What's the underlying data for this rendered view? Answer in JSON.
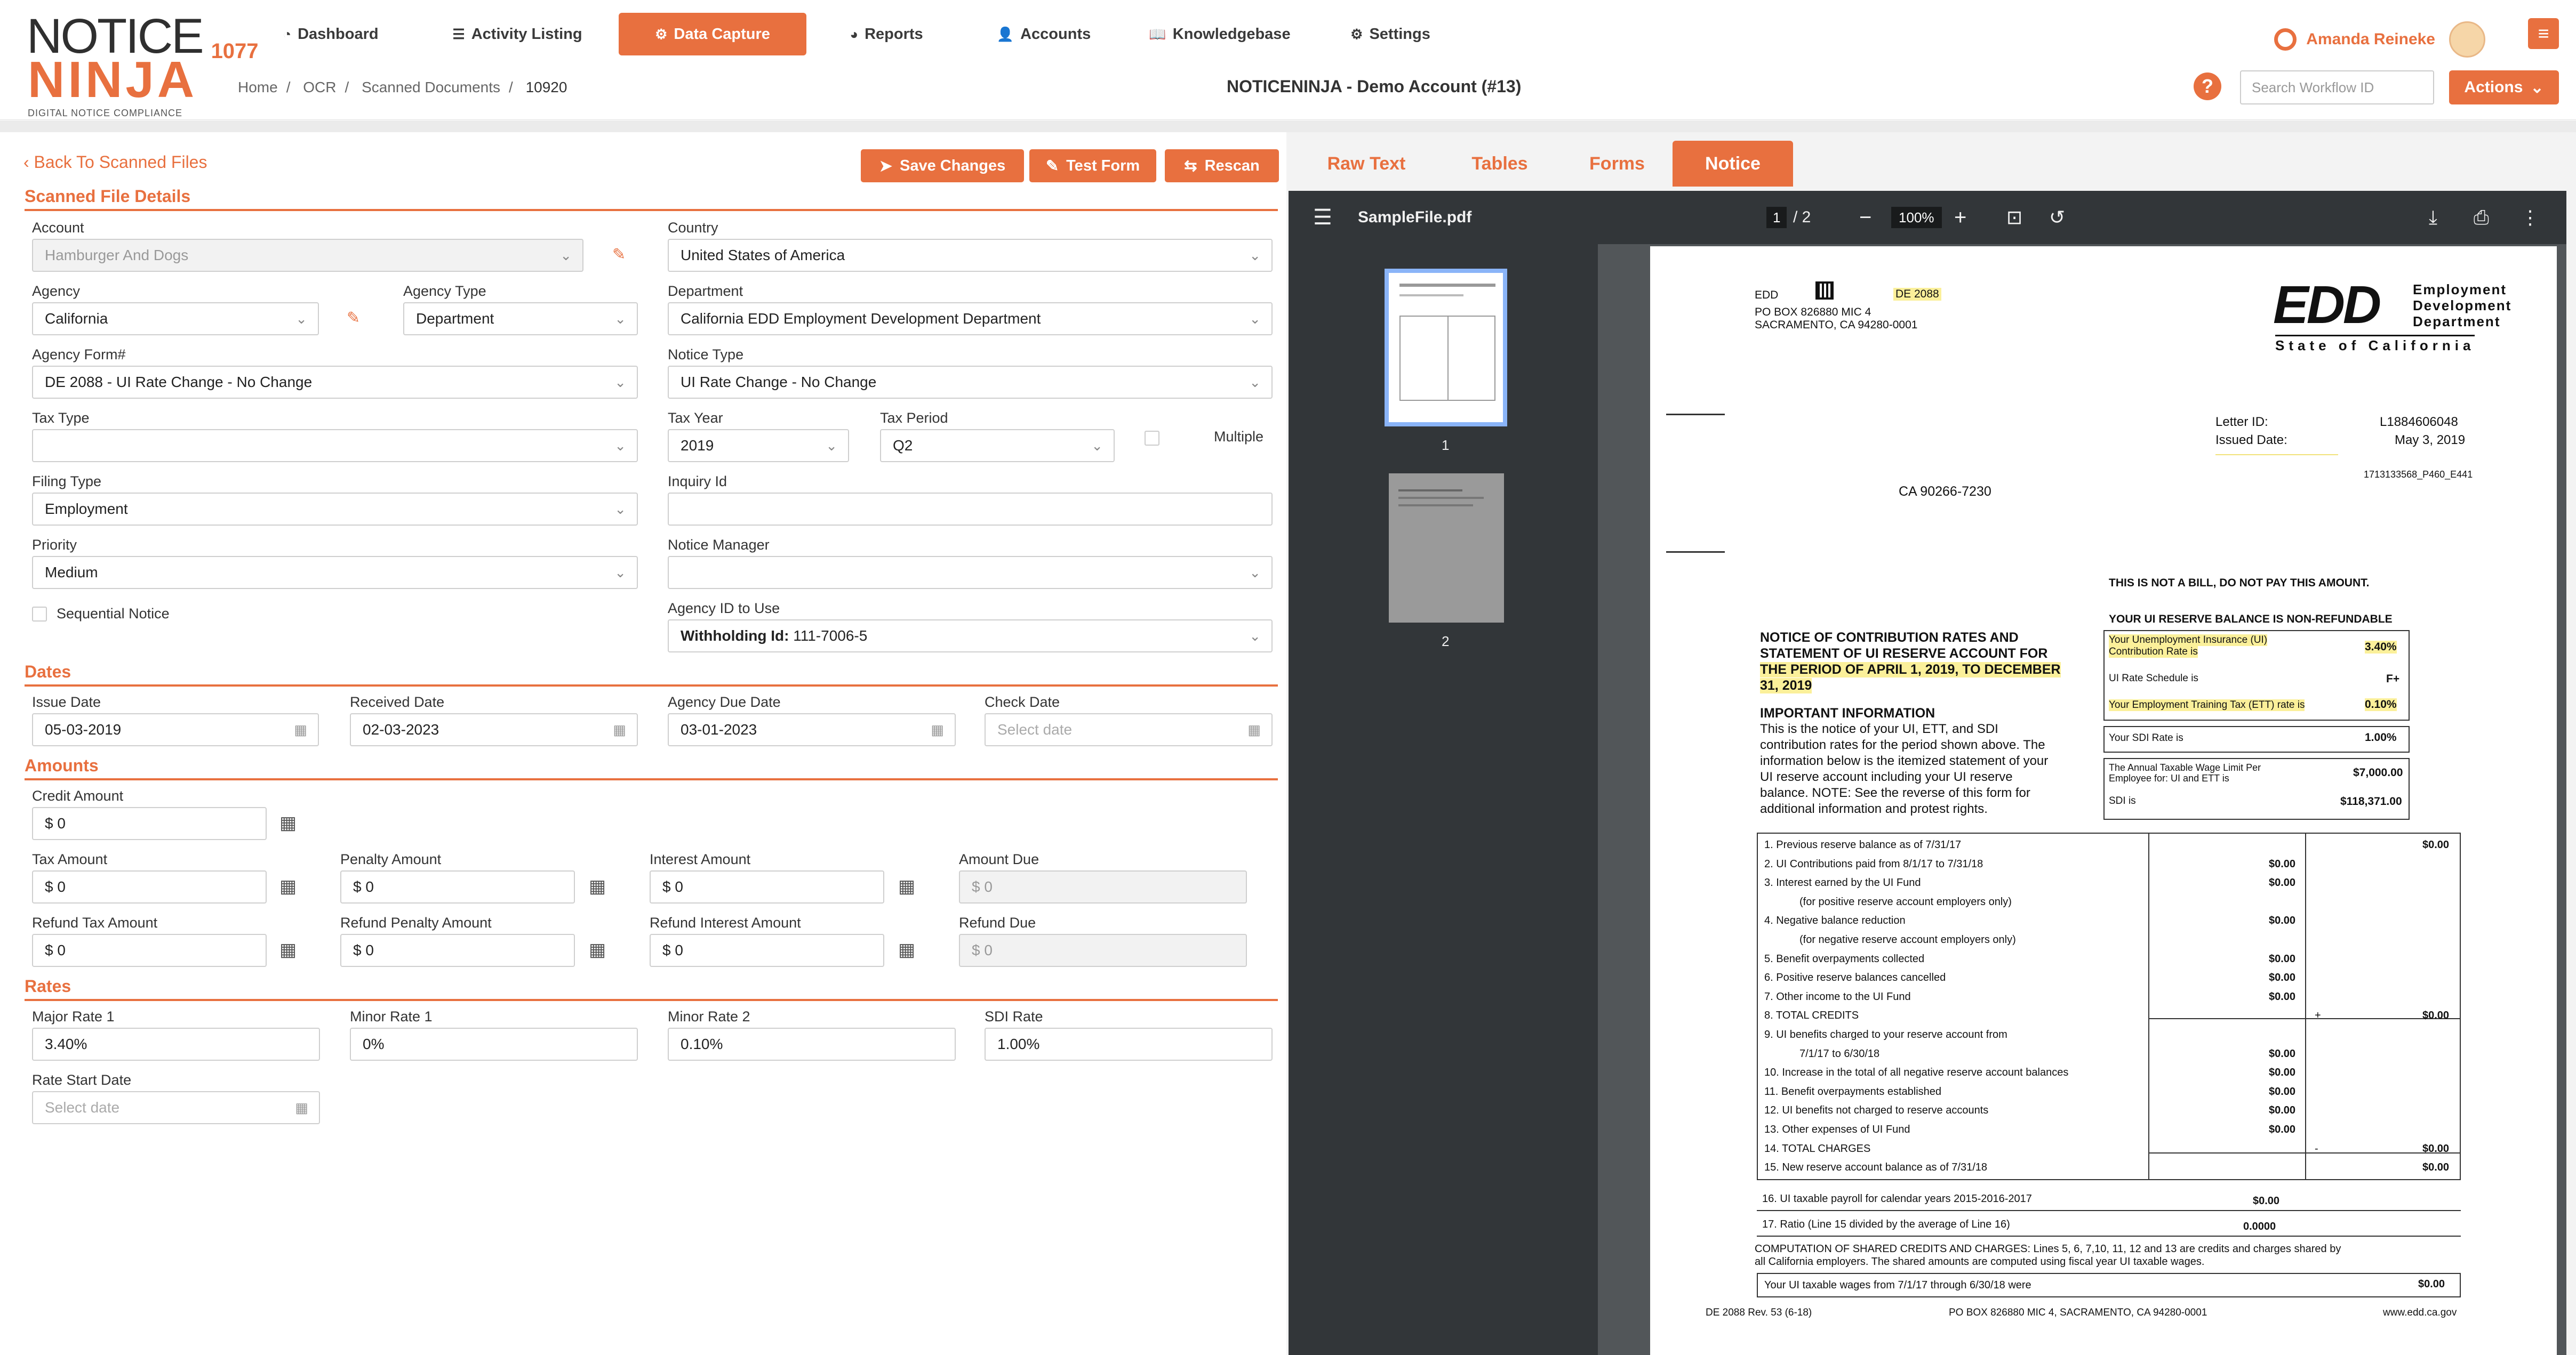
{
  "app": {
    "logo_notice": "NOTICE",
    "logo_number": "1077",
    "logo_ninja": "NINJA",
    "logo_tagline": "DIGITAL NOTICE COMPLIANCE",
    "accent_color": "#e8703f"
  },
  "nav": [
    {
      "label": "Dashboard",
      "icon": "dashboard-icon"
    },
    {
      "label": "Activity Listing",
      "icon": "list-icon"
    },
    {
      "label": "Data Capture",
      "icon": "gear-icon",
      "active": true
    },
    {
      "label": "Reports",
      "icon": "pie-chart-icon"
    },
    {
      "label": "Accounts",
      "icon": "user-icon"
    },
    {
      "label": "Knowledgebase",
      "icon": "book-icon"
    },
    {
      "label": "Settings",
      "icon": "cog-icon"
    }
  ],
  "user": {
    "name": "Amanda Reineke"
  },
  "breadcrumb": [
    "Home",
    "OCR",
    "Scanned Documents",
    "10920"
  ],
  "account_title": "NOTICENINJA - Demo Account (#13)",
  "search": {
    "placeholder": "Search Workflow ID"
  },
  "actions_label": "Actions",
  "form": {
    "back_label": "Back To Scanned Files",
    "save_label": "Save Changes",
    "test_label": "Test Form",
    "rescan_label": "Rescan",
    "section_details": "Scanned File Details",
    "account_label": "Account",
    "account_value": "Hamburger And Dogs",
    "country_label": "Country",
    "country_value": "United States of America",
    "agency_label": "Agency",
    "agency_value": "California",
    "agency_type_label": "Agency Type",
    "agency_type_value": "Department",
    "department_label": "Department",
    "department_value": "California EDD Employment Development Department",
    "agency_form_label": "Agency Form#",
    "agency_form_value": "DE 2088 - UI Rate Change - No Change",
    "notice_type_label": "Notice Type",
    "notice_type_value": "UI Rate Change - No Change",
    "tax_type_label": "Tax Type",
    "tax_type_value": "",
    "tax_year_label": "Tax Year",
    "tax_year_value": "2019",
    "tax_period_label": "Tax Period",
    "tax_period_value": "Q2",
    "multiple_label": "Multiple",
    "filing_type_label": "Filing Type",
    "filing_type_value": "Employment",
    "inquiry_label": "Inquiry Id",
    "inquiry_value": "",
    "priority_label": "Priority",
    "priority_value": "Medium",
    "notice_manager_label": "Notice Manager",
    "notice_manager_value": "",
    "sequential_label": "Sequential Notice",
    "agency_id_label": "Agency ID to Use",
    "agency_id_prefix": "Withholding Id:",
    "agency_id_value": "111-7006-5",
    "section_dates": "Dates",
    "issue_date_label": "Issue Date",
    "issue_date_value": "05-03-2019",
    "received_date_label": "Received Date",
    "received_date_value": "02-03-2023",
    "due_date_label": "Agency Due Date",
    "due_date_value": "03-01-2023",
    "check_date_label": "Check Date",
    "check_date_placeholder": "Select date",
    "section_amounts": "Amounts",
    "credit_label": "Credit Amount",
    "credit_value": "$ 0",
    "tax_amount_label": "Tax Amount",
    "tax_amount_value": "$ 0",
    "penalty_label": "Penalty Amount",
    "penalty_value": "$ 0",
    "interest_label": "Interest Amount",
    "interest_value": "$ 0",
    "amount_due_label": "Amount Due",
    "amount_due_value": "$ 0",
    "refund_tax_label": "Refund Tax Amount",
    "refund_tax_value": "$ 0",
    "refund_penalty_label": "Refund Penalty Amount",
    "refund_penalty_value": "$ 0",
    "refund_interest_label": "Refund Interest Amount",
    "refund_interest_value": "$ 0",
    "refund_due_label": "Refund Due",
    "refund_due_value": "$ 0",
    "section_rates": "Rates",
    "major_rate_label": "Major Rate 1",
    "major_rate_value": "3.40%",
    "minor_rate1_label": "Minor Rate 1",
    "minor_rate1_value": "0%",
    "minor_rate2_label": "Minor Rate 2",
    "minor_rate2_value": "0.10%",
    "sdi_rate_label": "SDI Rate",
    "sdi_rate_value": "1.00%",
    "rate_start_label": "Rate Start Date",
    "rate_start_placeholder": "Select date"
  },
  "tabs": [
    "Raw Text",
    "Tables",
    "Forms",
    "Notice"
  ],
  "viewer": {
    "file_name": "SampleFile.pdf",
    "page_current": "1",
    "page_total": "/ 2",
    "zoom": "100%",
    "thumb_labels": [
      "1",
      "2"
    ]
  },
  "doc": {
    "edd": "EDD",
    "form_badge": "DE 2088",
    "po_box": "PO BOX 826880 MIC 4",
    "city": "SACRAMENTO, CA 94280-0001",
    "logo_text": "EDD",
    "logo_dept1": "Employment",
    "logo_dept2": "Development",
    "logo_dept3": "Department",
    "logo_state": "State of California",
    "letter_id_label": "Letter ID:",
    "letter_id_value": "L1884606048",
    "issued_label": "Issued Date:",
    "issued_value": "May 3, 2019",
    "ref_code": "1713133568_P460_E441",
    "address_line": "CA  90266-7230",
    "not_bill": "THIS IS NOT A BILL, DO NOT PAY THIS AMOUNT.",
    "nonrefundable": "YOUR UI RESERVE BALANCE IS NON-REFUNDABLE",
    "title1": "NOTICE OF CONTRIBUTION RATES AND",
    "title2": "STATEMENT OF UI RESERVE ACCOUNT FOR",
    "title3": "THE PERIOD OF APRIL 1, 2019, TO DECEMBER",
    "title4": "31, 2019",
    "important": "IMPORTANT INFORMATION",
    "info1": "This is the notice of your UI, ETT, and SDI",
    "info2": "contribution rates for the period shown above. The",
    "info3": "information below is the itemized statement of your",
    "info4": "UI reserve account including your UI reserve",
    "info5": "balance. NOTE: See the reverse of this form for",
    "info6": "additional information and protest rights.",
    "ui_rate_label1": "Your Unemployment Insurance (UI)",
    "ui_rate_label2": "Contribution Rate is",
    "ui_rate_value": "3.40%",
    "schedule_label": "UI Rate Schedule is",
    "schedule_value": "F+",
    "ett_label": "Your Employment Training Tax (ETT) rate is",
    "ett_value": "0.10%",
    "sdi_label": "Your SDI Rate is",
    "sdi_value": "1.00%",
    "wage_label1": "The Annual Taxable Wage Limit Per",
    "wage_label2": "Employee for: UI and ETT is",
    "wage_value": "$7,000.00",
    "sdi_limit_label": "SDI is",
    "sdi_limit_value": "$118,371.00",
    "lines": [
      {
        "text": "1. Previous reserve balance as of 7/31/17",
        "amt": "",
        "total": "$0.00"
      },
      {
        "text": "2. UI Contributions paid from 8/1/17 to 7/31/18",
        "amt": "$0.00",
        "total": ""
      },
      {
        "text": "3. Interest earned by the UI Fund",
        "amt": "$0.00",
        "total": ""
      },
      {
        "text": "(for positive reserve account employers only)",
        "amt": "",
        "total": "",
        "indent": true
      },
      {
        "text": "4. Negative balance reduction",
        "amt": "$0.00",
        "total": ""
      },
      {
        "text": "(for negative reserve account employers only)",
        "amt": "",
        "total": "",
        "indent": true
      },
      {
        "text": "5. Benefit overpayments collected",
        "amt": "$0.00",
        "total": ""
      },
      {
        "text": "6. Positive reserve balances cancelled",
        "amt": "$0.00",
        "total": ""
      },
      {
        "text": "7. Other income to the UI Fund",
        "amt": "$0.00",
        "total": ""
      },
      {
        "text": "8.                           TOTAL CREDITS",
        "amt": "",
        "total": "$0.00",
        "sign": "+"
      },
      {
        "text": "9. UI benefits charged to your reserve account from",
        "amt": "",
        "total": ""
      },
      {
        "text": "7/1/17 to 6/30/18",
        "amt": "$0.00",
        "total": "",
        "indent": true
      },
      {
        "text": "10. Increase in the total of all negative reserve account balances",
        "amt": "$0.00",
        "total": ""
      },
      {
        "text": "11. Benefit overpayments established",
        "amt": "$0.00",
        "total": ""
      },
      {
        "text": "12. UI benefits not charged to reserve accounts",
        "amt": "$0.00",
        "total": ""
      },
      {
        "text": "13. Other expenses of UI Fund",
        "amt": "$0.00",
        "total": ""
      },
      {
        "text": "14.                          TOTAL CHARGES",
        "amt": "",
        "total": "$0.00",
        "sign": "-"
      },
      {
        "text": "15. New reserve account balance as of 7/31/18",
        "amt": "",
        "total": "$0.00"
      }
    ],
    "line16": "16. UI taxable payroll for calendar years 2015-2016-2017",
    "line16_value": "$0.00",
    "line17": "17. Ratio (Line 15 divided by the average of Line 16)",
    "line17_value": "0.0000",
    "comp1": "COMPUTATION OF SHARED CREDITS AND CHARGES: Lines 5, 6, 7,10, 11, 12 and 13 are credits and charges shared by",
    "comp2": "all California employers. The shared amounts are computed using fiscal year UI taxable wages.",
    "wages_line": "Your UI taxable wages from 7/1/17 through 6/30/18 were",
    "wages_value": "$0.00",
    "footer_form": "DE 2088 Rev. 53 (6-18)",
    "footer_po": "PO BOX 826880 MIC 4, SACRAMENTO, CA 94280-0001",
    "footer_web": "www.edd.ca.gov"
  }
}
